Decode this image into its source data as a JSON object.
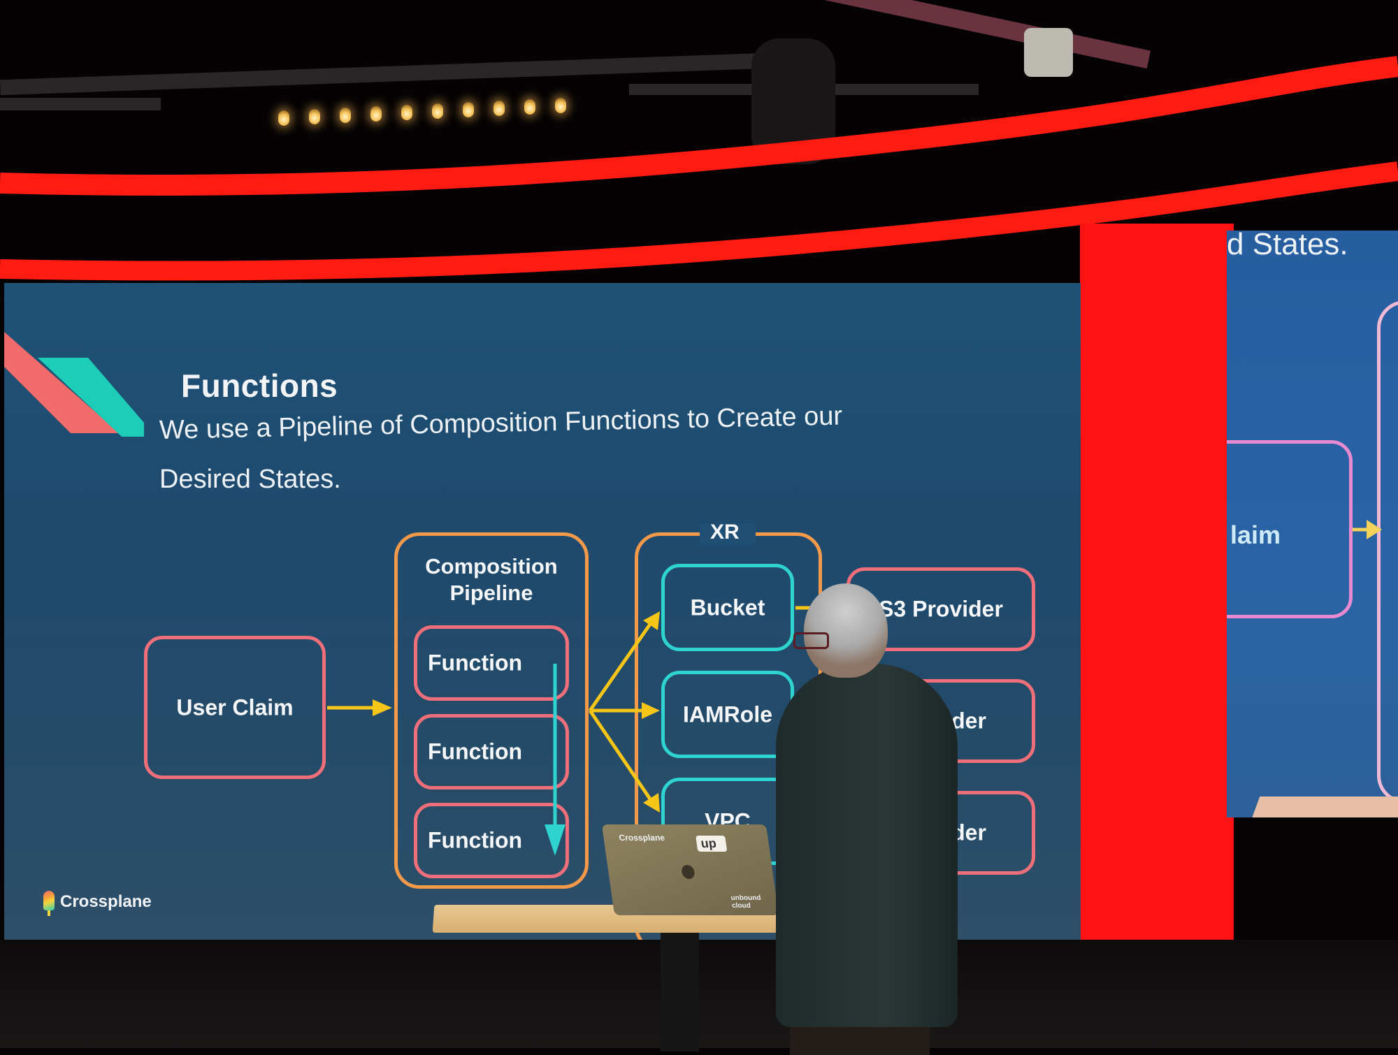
{
  "slide": {
    "title": "Functions",
    "subtitle_line1": "We use a Pipeline of Composition Functions to Create our",
    "subtitle_line2": "Desired States.",
    "footer_logo_text": "Crossplane",
    "accent_colors": {
      "background": "#1f4e73",
      "pink_border": "#ee6f7a",
      "orange_border": "#f2994a",
      "cyan_border": "#2fd3d0",
      "arrow_yellow": "#f5c518",
      "arrow_cyan": "#2fd3d0",
      "logo_pink": "#f26b6b",
      "logo_teal": "#1ecdb7"
    },
    "diagram": {
      "user_claim": "User Claim",
      "pipeline_title_line1": "Composition",
      "pipeline_title_line2": "Pipeline",
      "functions": [
        "Function",
        "Function",
        "Function"
      ],
      "xr_label": "XR",
      "resources": [
        "Bucket",
        "IAMRole",
        "VPC"
      ],
      "providers": [
        "S3 Provider",
        "Provider",
        "Provider"
      ]
    }
  },
  "secondary_screen": {
    "text_fragment": "d States.",
    "claim_fragment": "laim"
  },
  "stage": {
    "laptop_stickers": [
      "Crossplane",
      "up",
      "unbound cloud"
    ],
    "red_panel_color": "#ff1212",
    "led_strip_color": "#ff1a12"
  }
}
